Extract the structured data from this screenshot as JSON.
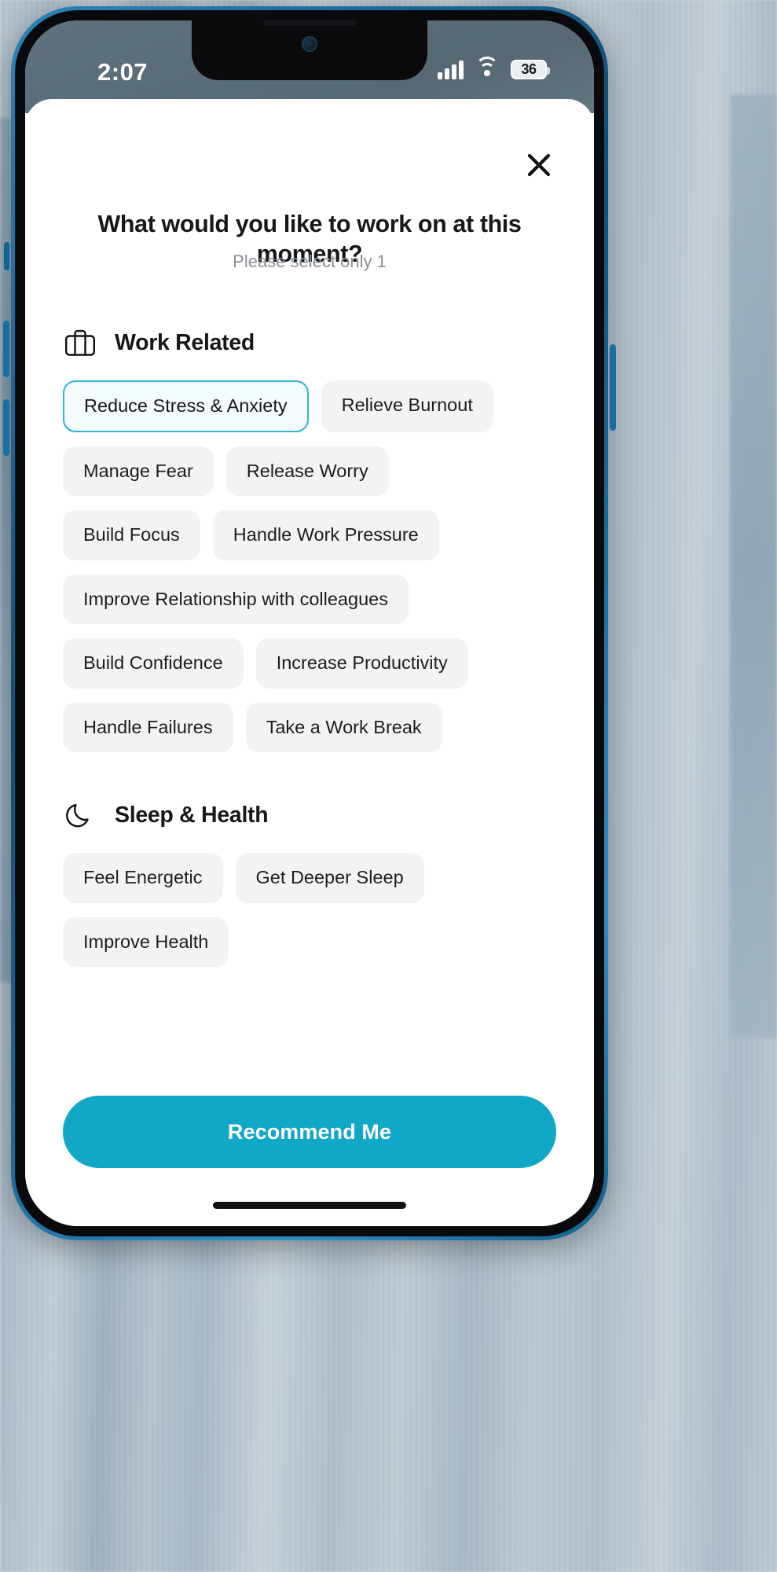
{
  "status_bar": {
    "time": "2:07",
    "battery_level": "36",
    "signal_icon": "cellular-signal-icon",
    "wifi_icon": "wifi-icon",
    "battery_icon": "battery-icon"
  },
  "modal": {
    "close_icon": "close-icon",
    "title": "What would you like to work on at this moment?",
    "subtitle": "Please select only 1",
    "sections": [
      {
        "id": "work-related",
        "icon": "briefcase-icon",
        "title": "Work Related",
        "rows": [
          [
            {
              "label": "Reduce Stress & Anxiety",
              "selected": true
            },
            {
              "label": "Relieve Burnout",
              "selected": false
            }
          ],
          [
            {
              "label": "Manage Fear",
              "selected": false
            },
            {
              "label": "Release Worry",
              "selected": false
            }
          ],
          [
            {
              "label": "Build Focus",
              "selected": false
            },
            {
              "label": "Handle Work Pressure",
              "selected": false
            }
          ],
          [
            {
              "label": "Improve Relationship with colleagues",
              "selected": false
            }
          ],
          [
            {
              "label": "Build Confidence",
              "selected": false
            },
            {
              "label": "Increase Productivity",
              "selected": false
            }
          ],
          [
            {
              "label": "Handle Failures",
              "selected": false
            },
            {
              "label": "Take a Work Break",
              "selected": false
            }
          ]
        ]
      },
      {
        "id": "sleep-health",
        "icon": "moon-icon",
        "title": "Sleep & Health",
        "rows": [
          [
            {
              "label": "Feel Energetic",
              "selected": false
            },
            {
              "label": "Get Deeper Sleep",
              "selected": false
            }
          ],
          [
            {
              "label": "Improve Health",
              "selected": false
            }
          ]
        ]
      }
    ],
    "cta_label": "Recommend Me"
  },
  "colors": {
    "accent": "#11a7c6",
    "selected_border": "#2fb3d6",
    "selected_fill": "#f4fbfd",
    "chip_fill": "#f2f3f5",
    "text_primary": "#16181a",
    "text_muted": "#8b9095",
    "status_bar_bg": "#5a6d7a"
  }
}
